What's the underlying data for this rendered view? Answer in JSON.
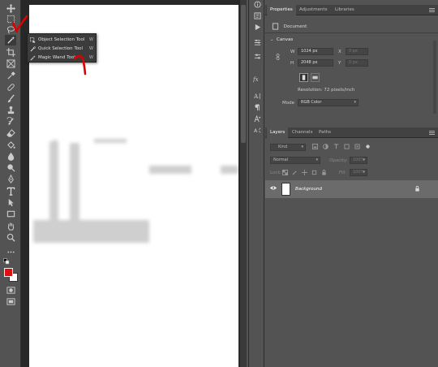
{
  "flyout": {
    "items": [
      {
        "label": "Object Selection Tool",
        "shortcut": "W"
      },
      {
        "label": "Quick Selection Tool",
        "shortcut": "W"
      },
      {
        "label": "Magic Wand Tool",
        "shortcut": "W"
      }
    ]
  },
  "properties": {
    "tabs": [
      "Properties",
      "Adjustments",
      "Libraries"
    ],
    "doc_label": "Document",
    "canvas_section": "Canvas",
    "width_label": "W",
    "width_value": "1024 px",
    "height_label": "H",
    "height_value": "2048 px",
    "x_label": "X",
    "x_value": "0 px",
    "y_label": "Y",
    "y_value": "0 px",
    "resolution": "Resolution: 72 pixels/inch",
    "mode_label": "Mode",
    "mode_value": "RGB Color"
  },
  "layers": {
    "tabs": [
      "Layers",
      "Channels",
      "Paths"
    ],
    "kind_placeholder": "Kind",
    "blend_mode": "Normal",
    "opacity_label": "Opacity:",
    "opacity_value": "100%",
    "lock_label": "Lock:",
    "fill_label": "Fill:",
    "fill_value": "100%",
    "layer_name": "Background"
  },
  "colors": {
    "foreground": "#e01010",
    "background": "#ffffff",
    "annotation": "#e00000"
  }
}
